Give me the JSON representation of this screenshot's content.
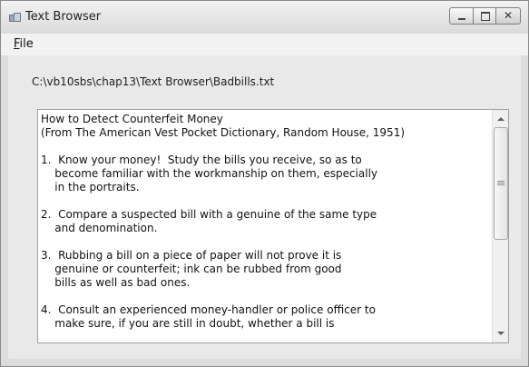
{
  "window": {
    "title": "Text Browser",
    "icon": "app-window-icon",
    "controls": {
      "minimize": "minimize-icon",
      "maximize": "maximize-icon",
      "close": "close-icon",
      "close_glyph": "✕"
    }
  },
  "menu": {
    "file_label": "File",
    "file_underline": "F",
    "file_rest": "ile"
  },
  "file_path": "C:\\vb10sbs\\chap13\\Text Browser\\Badbills.txt",
  "document": {
    "text": "How to Detect Counterfeit Money\n(From The American Vest Pocket Dictionary, Random House, 1951)\n\n1.  Know your money!  Study the bills you receive, so as to\n    become familiar with the workmanship on them, especially\n    in the portraits.\n\n2.  Compare a suspected bill with a genuine of the same type\n    and denomination.\n\n3.  Rubbing a bill on a piece of paper will not prove it is\n    genuine or counterfeit; ink can be rubbed from good\n    bills as well as bad ones.\n\n4.  Consult an experienced money-handler or police officer to\n    make sure, if you are still in doubt, whether a bill is"
  },
  "scrollbar": {
    "position_fraction": 0.0,
    "visible_fraction": 0.55
  }
}
